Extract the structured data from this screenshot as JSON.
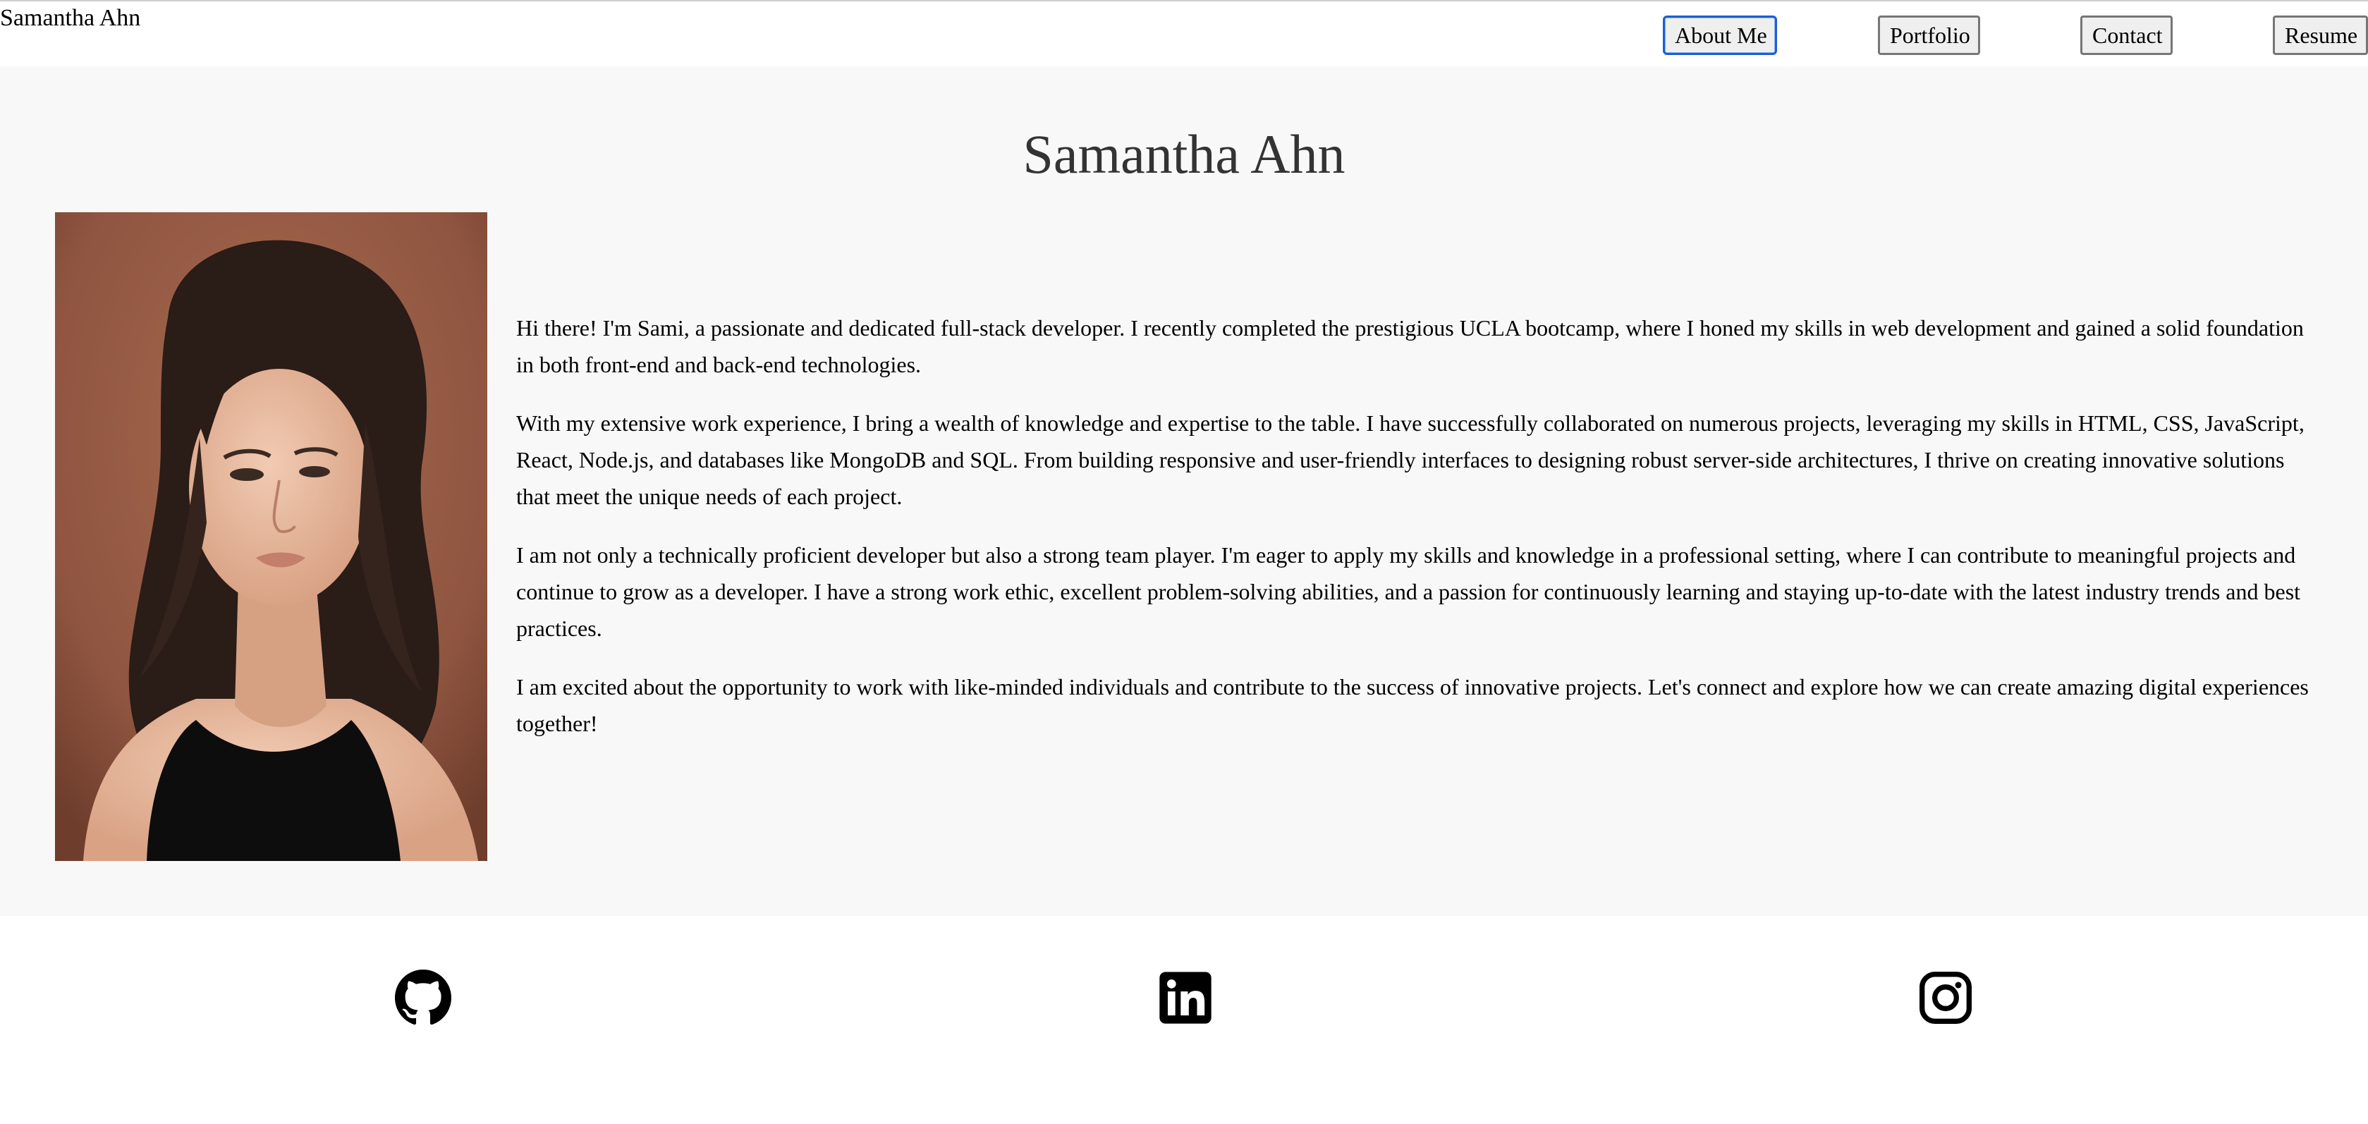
{
  "header": {
    "brand": "Samantha Ahn",
    "nav": {
      "about": "About Me",
      "portfolio": "Portfolio",
      "contact": "Contact",
      "resume": "Resume"
    },
    "active_tab": "About Me"
  },
  "about": {
    "title": "Samantha Ahn",
    "photo": "portrait-photo",
    "paragraphs": [
      "Hi there! I'm Sami, a passionate and dedicated full-stack developer. I recently completed the prestigious UCLA bootcamp, where I honed my skills in web development and gained a solid foundation in both front-end and back-end technologies.",
      "With my extensive work experience, I bring a wealth of knowledge and expertise to the table. I have successfully collaborated on numerous projects, leveraging my skills in HTML, CSS, JavaScript, React, Node.js, and databases like MongoDB and SQL. From building responsive and user-friendly interfaces to designing robust server-side architectures, I thrive on creating innovative solutions that meet the unique needs of each project.",
      "I am not only a technically proficient developer but also a strong team player. I'm eager to apply my skills and knowledge in a professional setting, where I can contribute to meaningful projects and continue to grow as a developer. I have a strong work ethic, excellent problem-solving abilities, and a passion for continuously learning and staying up-to-date with the latest industry trends and best practices.",
      "I am excited about the opportunity to work with like-minded individuals and contribute to the success of innovative projects. Let's connect and explore how we can create amazing digital experiences together!"
    ]
  },
  "footer": {
    "icons": [
      "github-icon",
      "linkedin-icon",
      "instagram-icon"
    ]
  },
  "colors": {
    "section_bg": "#f8f8f8",
    "title": "#333333",
    "active_border": "#1a5fd6",
    "button_bg": "#efefef",
    "photo_bg": "#9a5a42"
  }
}
